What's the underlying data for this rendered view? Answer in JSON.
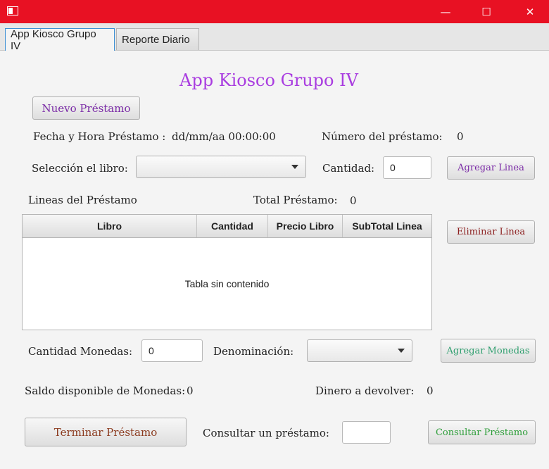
{
  "window": {
    "minimize": "—",
    "maximize": "☐",
    "close": "✕"
  },
  "tabs": [
    {
      "label": "App Kiosco Grupo IV"
    },
    {
      "label": "Reporte Diario"
    }
  ],
  "main": {
    "title": "App Kiosco Grupo IV",
    "nuevo_prestamo": "Nuevo Préstamo",
    "fecha_label": "Fecha y Hora Préstamo :",
    "fecha_value": "dd/mm/aa 00:00:00",
    "numero_label": "Número del préstamo:",
    "numero_value": "0",
    "seleccion_label": "Selección el libro:",
    "cantidad_label": "Cantidad:",
    "cantidad_value": "0",
    "agregar_linea": "Agregar Linea",
    "lineas_label": "Lineas del Préstamo",
    "total_label": "Total Préstamo:",
    "total_value": "0",
    "table": {
      "columns": [
        "Libro",
        "Cantidad",
        "Precio Libro",
        "SubTotal Linea"
      ],
      "empty_text": "Tabla sin contenido"
    },
    "eliminar_linea": "Eliminar Linea",
    "cantidad_monedas_label": "Cantidad Monedas:",
    "cantidad_monedas_value": "0",
    "denominacion_label": "Denominación:",
    "agregar_monedas": "Agregar Monedas",
    "saldo_label": "Saldo disponible de Monedas:",
    "saldo_value": "0",
    "devolver_label": "Dinero a devolver:",
    "devolver_value": "0",
    "terminar": "Terminar Préstamo",
    "consultar_label": "Consultar un préstamo:",
    "consultar_value": "",
    "consultar_btn": "Consultar Préstamo"
  },
  "colors": {
    "titlebar": "#e81123",
    "title": "#a93ce0",
    "nuevo": "#7a2aa6",
    "agregar_linea": "#7a2aa6",
    "eliminar": "#8b1e1e",
    "agregar_monedas": "#2e9e6e",
    "terminar": "#8b3a1e",
    "consultar": "#2e9e3a"
  }
}
